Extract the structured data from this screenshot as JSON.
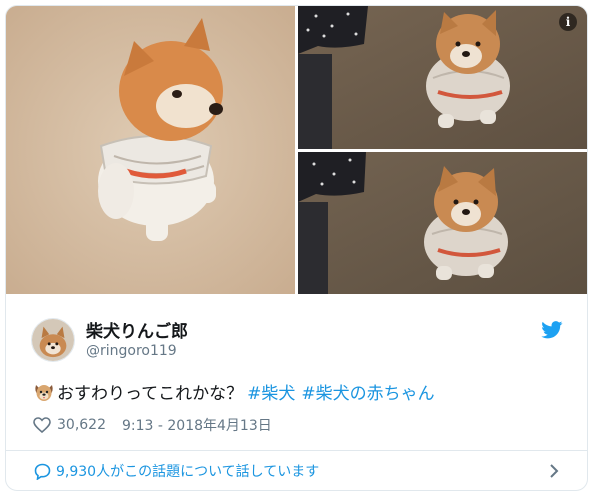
{
  "media": {
    "images": [
      {
        "alt": "shiba-puppy-sitting-closeup"
      },
      {
        "alt": "shiba-puppy-on-carpet-top"
      },
      {
        "alt": "shiba-puppy-on-carpet-bottom"
      }
    ],
    "info_icon": "info-icon"
  },
  "author": {
    "name": "柴犬りんご郎",
    "handle": "@ringoro119"
  },
  "tweet": {
    "emoji": "dog-face",
    "text": "おすわりってこれかな？",
    "hashtags": [
      "#柴犬",
      "#柴犬の赤ちゃん"
    ]
  },
  "meta": {
    "likes": "30,622",
    "timestamp": "9:13 - 2018年4月13日"
  },
  "conversation": {
    "label": "9,930人がこの話題について話しています"
  },
  "colors": {
    "link": "#1b95e0",
    "muted": "#657786",
    "border": "#e1e8ed",
    "twitter_blue": "#1da1f2"
  }
}
